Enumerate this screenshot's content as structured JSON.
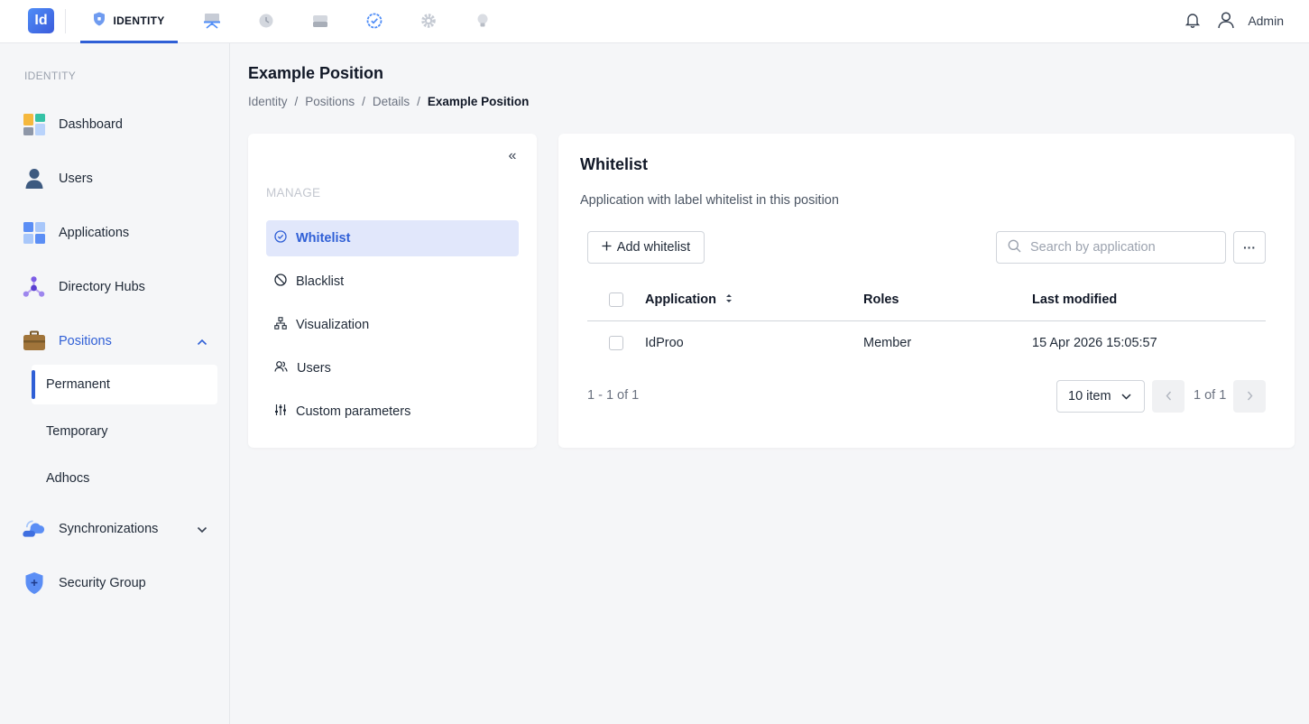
{
  "topbar": {
    "logo_text": "Id",
    "active_app_label": "IDENTITY",
    "app_icons": [
      "shield-icon",
      "presentation-icon",
      "history-icon",
      "drive-icon",
      "check-circle-icon",
      "settings-gear-icon",
      "lightbulb-icon"
    ],
    "user_name": "Admin"
  },
  "sidebar": {
    "section_label": "IDENTITY",
    "items": [
      {
        "label": "Dashboard",
        "icon": "dashboard-icon"
      },
      {
        "label": "Users",
        "icon": "user-icon"
      },
      {
        "label": "Applications",
        "icon": "applications-icon"
      },
      {
        "label": "Directory Hubs",
        "icon": "directory-hub-icon"
      },
      {
        "label": "Positions",
        "icon": "briefcase-icon",
        "expanded": true
      },
      {
        "label": "Synchronizations",
        "icon": "cloud-sync-icon",
        "expanded": false
      },
      {
        "label": "Security Group",
        "icon": "shield-plus-icon"
      }
    ],
    "positions_sub": [
      "Permanent",
      "Temporary",
      "Adhocs"
    ]
  },
  "page": {
    "title": "Example Position",
    "breadcrumb": [
      "Identity",
      "Positions",
      "Details",
      "Example Position"
    ]
  },
  "manage": {
    "collapse_glyph": "«",
    "label": "MANAGE",
    "items": [
      "Whitelist",
      "Blacklist",
      "Visualization",
      "Users",
      "Custom parameters"
    ],
    "active": "Whitelist"
  },
  "whitelist": {
    "title": "Whitelist",
    "description": "Application with label whitelist in this position",
    "add_label": "Add whitelist",
    "search_placeholder": "Search by application",
    "more_glyph": "···",
    "columns": [
      "Application",
      "Roles",
      "Last modified"
    ],
    "rows": [
      {
        "application": "IdProo",
        "roles": "Member",
        "last_modified": "15 Apr 2026 15:05:57"
      }
    ],
    "range_text": "1 - 1 of 1",
    "page_size": "10 item",
    "page_info": "1 of 1"
  },
  "colors": {
    "accent": "#2f5fd6",
    "active_bg": "#e1e7fb",
    "background": "#f5f6f8"
  }
}
